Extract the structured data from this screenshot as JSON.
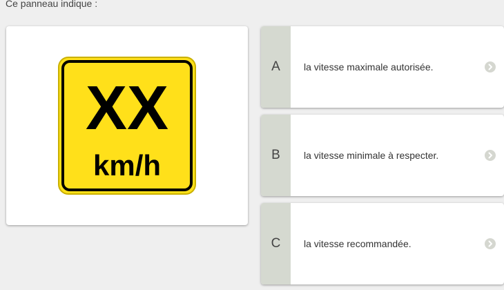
{
  "question": {
    "text": "Ce panneau indique :"
  },
  "sign": {
    "main_text": "XX",
    "unit_text": "km/h",
    "background_color": "#ffe01a",
    "border_color": "#000000"
  },
  "answers": [
    {
      "letter": "A",
      "text": "la vitesse maximale autorisée."
    },
    {
      "letter": "B",
      "text": "la vitesse minimale à respecter."
    },
    {
      "letter": "C",
      "text": "la vitesse recommandée."
    }
  ],
  "colors": {
    "letter_background": "#d5d9d0",
    "arrow_background": "#d5d7d0",
    "page_background": "#efefef"
  },
  "icons": {
    "answer_arrow": "chevron-right-circle-icon"
  }
}
